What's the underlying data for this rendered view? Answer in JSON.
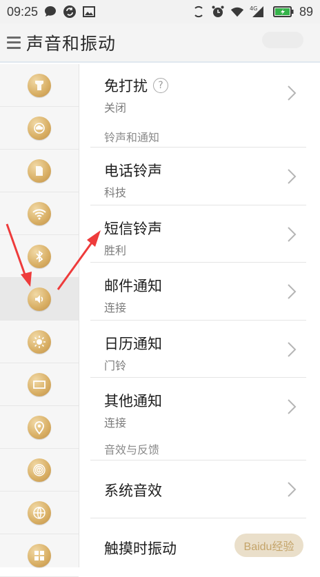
{
  "status_bar": {
    "time": "09:25",
    "network": "4G",
    "battery": "89",
    "icons": [
      "chat-icon",
      "sync-icon",
      "image-icon",
      "rotate-icon",
      "alarm-icon",
      "wifi-icon",
      "signal-icon",
      "battery-icon"
    ]
  },
  "header": {
    "title": "声音和振动"
  },
  "sidebar": {
    "items": [
      {
        "icon": "personalize-icon"
      },
      {
        "icon": "cloud-icon"
      },
      {
        "icon": "sim-icon"
      },
      {
        "icon": "wifi-icon"
      },
      {
        "icon": "bluetooth-icon"
      },
      {
        "icon": "sound-icon",
        "active": true
      },
      {
        "icon": "brightness-icon"
      },
      {
        "icon": "display-icon"
      },
      {
        "icon": "location-icon"
      },
      {
        "icon": "fingerprint-icon"
      },
      {
        "icon": "globe-icon"
      },
      {
        "icon": "apps-icon"
      }
    ]
  },
  "content": {
    "dnd": {
      "title": "免打扰",
      "value": "关闭"
    },
    "section_ringtones": "铃声和通知",
    "phone_ringtone": {
      "title": "电话铃声",
      "value": "科技"
    },
    "sms_ringtone": {
      "title": "短信铃声",
      "value": "胜利"
    },
    "mail_notify": {
      "title": "邮件通知",
      "value": "连接"
    },
    "calendar_notify": {
      "title": "日历通知",
      "value": "门铃"
    },
    "other_notify": {
      "title": "其他通知",
      "value": "连接"
    },
    "section_effects": "音效与反馈",
    "system_sound": {
      "title": "系统音效"
    },
    "touch_vibrate": {
      "title": "触摸时振动"
    }
  },
  "watermark": {
    "text": "Baidu经验"
  },
  "colors": {
    "accent_arrow": "#ee3b3b",
    "coin": "#d8ae63"
  }
}
